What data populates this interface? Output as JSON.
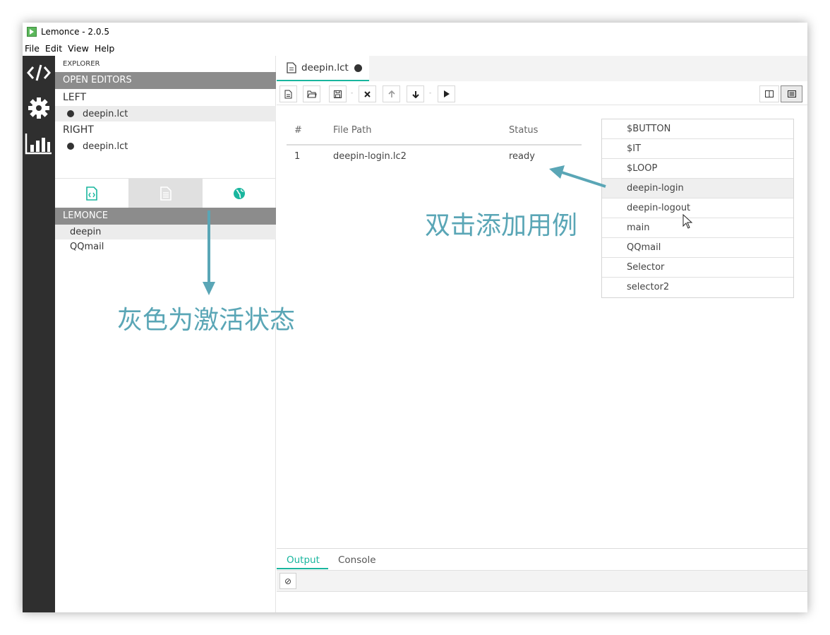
{
  "app": {
    "title": "Lemonce - 2.0.5",
    "accent": "#19b69e"
  },
  "menu": [
    "File",
    "Edit",
    "View",
    "Help"
  ],
  "activity": [
    "code-icon",
    "gear-icon",
    "chart-icon"
  ],
  "sidebar": {
    "explorer_label": "EXPLORER",
    "open_editors": "OPEN EDITORS",
    "left_label": "LEFT",
    "left_file": "deepin.lct",
    "right_label": "RIGHT",
    "right_file": "deepin.lct",
    "lemonce_header": "LEMONCE",
    "files": [
      "deepin",
      "QQmail"
    ]
  },
  "editor": {
    "tab": "deepin.lct",
    "table": {
      "headers": [
        "#",
        "File Path",
        "Status"
      ],
      "rows": [
        {
          "num": "1",
          "path": "deepin-login.lc2",
          "status": "ready"
        }
      ]
    },
    "cases": [
      "$BUTTON",
      "$IT",
      "$LOOP",
      "deepin-login",
      "deepin-logout",
      "main",
      "QQmail",
      "Selector",
      "selector2"
    ]
  },
  "bottom": {
    "tabs": [
      "Output",
      "Console"
    ],
    "clear_symbol": "⊘"
  },
  "annotations": {
    "double_click": "双击添加用例",
    "gray_active": "灰色为激活状态",
    "color": "#5aa6b6"
  }
}
